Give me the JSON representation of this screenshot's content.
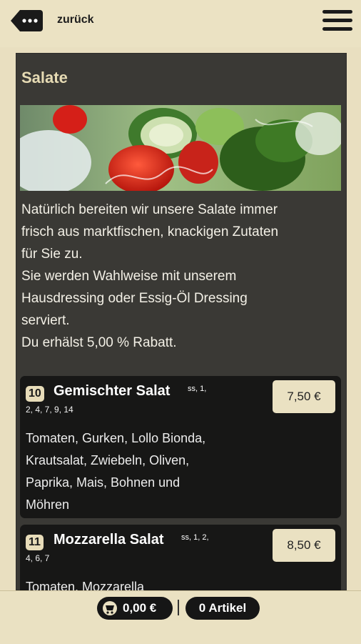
{
  "header": {
    "back_label": "zurück",
    "back_icon": "ellipsis-tag-icon",
    "menu_icon": "hamburger-menu-icon"
  },
  "category": {
    "title": "Salate",
    "intro": [
      "Natürlich bereiten wir unsere Salate immer",
      "frisch aus marktfischen, knackigen Zutaten",
      "für Sie zu.",
      "Sie werden Wahlweise mit unserem",
      "Hausdressing oder Essig-Öl Dressing",
      "serviert.",
      "Du erhälst 5,00 % Rabatt."
    ]
  },
  "items": [
    {
      "number": "10",
      "name": "Gemischter Salat",
      "allergens_sup": "ss, 1,",
      "allergens_line": "2, 4, 7, 9, 14",
      "price": "7,50 €",
      "description": [
        "Tomaten, Gurken, Lollo Bionda,",
        "Krautsalat, Zwiebeln, Oliven,",
        "Paprika, Mais, Bohnen und",
        "Möhren"
      ]
    },
    {
      "number": "11",
      "name": "Mozzarella Salat",
      "allergens_sup": "ss, 1, 2,",
      "allergens_line": "4, 6, 7",
      "price": "8,50 €",
      "description": [
        "Tomaten, Mozzarella"
      ]
    }
  ],
  "footer": {
    "cart_total": "0,00 €",
    "cart_icon": "shopping-cart-icon",
    "article_count": "0 Artikel"
  },
  "colors": {
    "background": "#e9dfc0",
    "panel": "#3a3935",
    "card": "#171716",
    "accent": "#e6dbb4"
  }
}
